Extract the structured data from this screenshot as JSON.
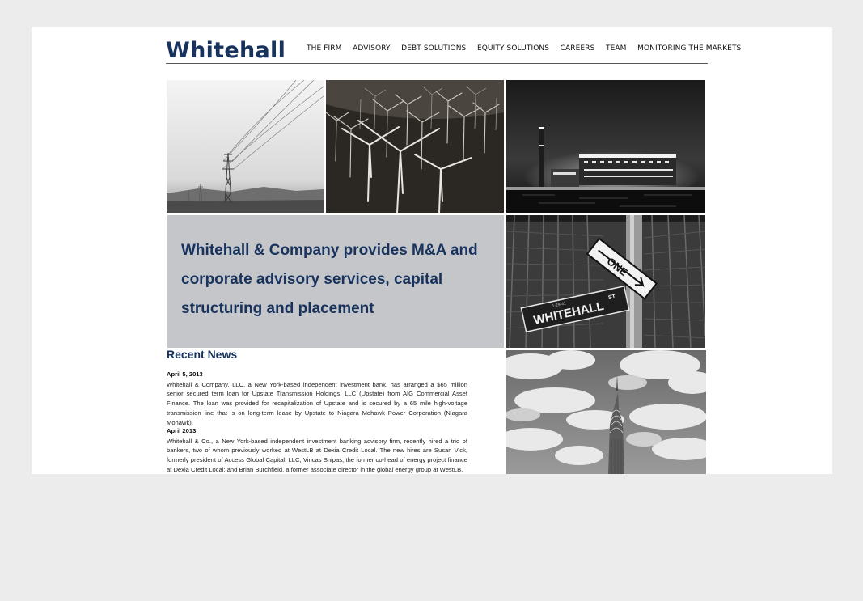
{
  "brand": {
    "logo_text": "Whitehall",
    "color": "#17325c"
  },
  "nav": {
    "items": [
      {
        "label": "THE FIRM"
      },
      {
        "label": "ADVISORY"
      },
      {
        "label": "DEBT SOLUTIONS"
      },
      {
        "label": "EQUITY SOLUTIONS"
      },
      {
        "label": "CAREERS"
      },
      {
        "label": "TEAM"
      },
      {
        "label": "MONITORING THE MARKETS"
      }
    ]
  },
  "hero": {
    "text": "Whitehall & Company provides M&A and corporate advisory services, capital structuring and placement",
    "background": "#c5c6ca"
  },
  "news": {
    "heading": "Recent News",
    "items": [
      {
        "date": "April 5, 2013",
        "body": "Whitehall & Company, LLC, a New York-based independent investment bank, has arranged a $65 million senior secured term loan for Upstate Transmission Holdings, LLC (Upstate) from AIG Commercial Asset Finance. The loan was provided for recapitalization of Upstate and is secured by a 65 mile high-voltage transmission line that is on long-term lease by Upstate to Niagara Mohawk Power Corporation (Niagara Mohawk)."
      },
      {
        "date": "April 2013",
        "body": "Whitehall & Co., a New York-based independent investment banking advisory firm, recently hired a trio of bankers, two of whom previously worked at WestLB at Dexia Credit Local. The new hires are Susan Vick, formerly president of Access Global Capital, LLC; Vincas Snipas, the former co-head of energy project finance at Dexia Credit Local; and Brian Burchfield, a former associate director in the global energy group at WestLB."
      }
    ]
  },
  "photo_signs": {
    "one_way": "ONE",
    "street_name": "WHITEHALL",
    "street_suffix": "ST",
    "block_number": "1-29-41"
  }
}
